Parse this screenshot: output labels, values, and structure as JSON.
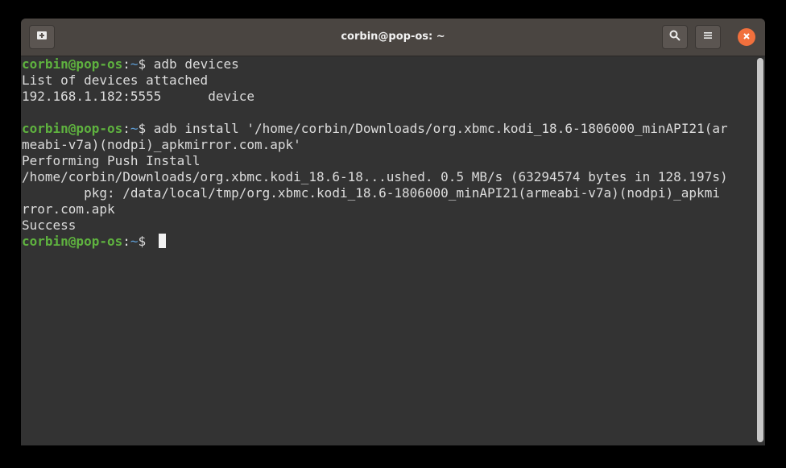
{
  "window": {
    "title": "corbin@pop-os: ~"
  },
  "header": {
    "new_tab_icon": "new-tab-icon",
    "search_icon": "search-icon",
    "menu_icon": "hamburger-menu-icon",
    "close_icon": "close-icon"
  },
  "terminal": {
    "prompt_user": "corbin@pop-os",
    "prompt_sep": ":",
    "prompt_path": "~",
    "prompt_dollar": "$ ",
    "cmd1": "adb devices",
    "out1": "List of devices attached",
    "out2": "192.168.1.182:5555      device",
    "cmd2a": "adb install '/home/corbin/Downloads/org.xbmc.kodi_18.6-1806000_minAPI21(ar",
    "cmd2b": "meabi-v7a)(nodpi)_apkmirror.com.apk'",
    "out3": "Performing Push Install",
    "out4": "/home/corbin/Downloads/org.xbmc.kodi_18.6-18...ushed. 0.5 MB/s (63294574 bytes in 128.197s)",
    "out5": "        pkg: /data/local/tmp/org.xbmc.kodi_18.6-1806000_minAPI21(armeabi-v7a)(nodpi)_apkmi",
    "out6": "rror.com.apk",
    "out7": "Success"
  },
  "colors": {
    "prompt_user": "#5fb33f",
    "prompt_path": "#5e9ed6",
    "close_button": "#f1703d",
    "terminal_bg": "#333333"
  }
}
